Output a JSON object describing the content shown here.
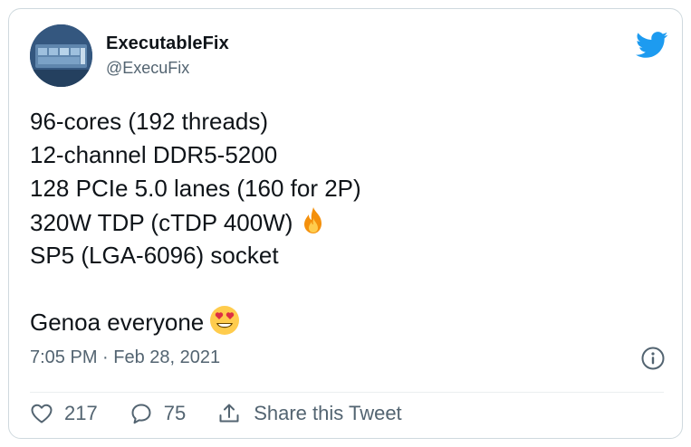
{
  "author": {
    "display_name": "ExecutableFix",
    "handle": "@ExecuFix"
  },
  "tweet": {
    "lines": [
      "96-cores (192 threads)",
      "12-channel DDR5-5200",
      "128 PCIe 5.0 lanes (160 for 2P)",
      "320W TDP (cTDP 400W)",
      "SP5 (LGA-6096) socket",
      "Genoa everyone"
    ],
    "emoji_line4": "fire-emoji",
    "emoji_line6": "heart-eyes-emoji"
  },
  "meta": {
    "timestamp": "7:05 PM · Feb 28, 2021"
  },
  "actions": {
    "likes": "217",
    "replies": "75",
    "share_label": "Share this Tweet"
  },
  "colors": {
    "twitter_blue": "#1d9bf0",
    "secondary_text": "#536471",
    "border": "#cfd9de"
  }
}
